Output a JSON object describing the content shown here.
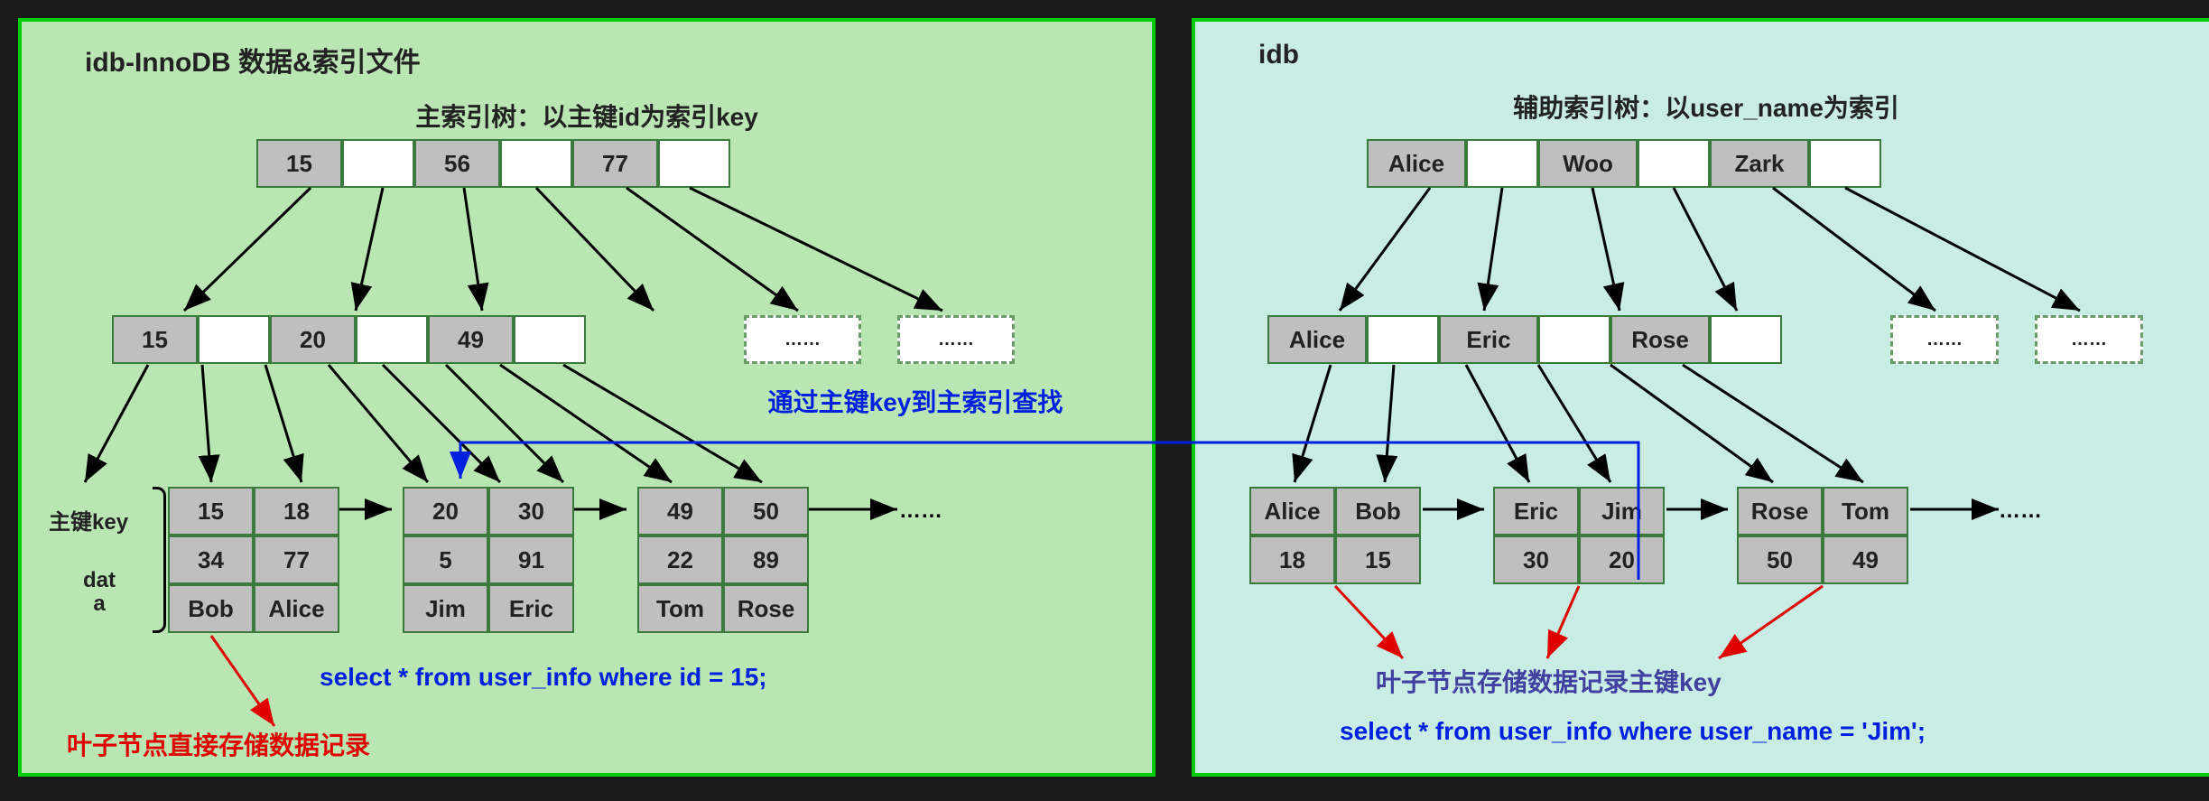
{
  "left_panel": {
    "title": "idb-InnoDB 数据&索引文件",
    "tree_title": "主索引树：以主键id为索引key",
    "root": [
      "15",
      "",
      "56",
      "",
      "77",
      ""
    ],
    "mid": [
      "15",
      "",
      "20",
      "",
      "49",
      ""
    ],
    "dashed_cell": "……",
    "leaf_label_key": "主键key",
    "leaf_label_data1": "dat",
    "leaf_label_data2": "a",
    "leaf1": [
      [
        "15",
        "18"
      ],
      [
        "34",
        "77"
      ],
      [
        "Bob",
        "Alice"
      ]
    ],
    "leaf2": [
      [
        "20",
        "30"
      ],
      [
        "5",
        "91"
      ],
      [
        "Jim",
        "Eric"
      ]
    ],
    "leaf3": [
      [
        "49",
        "50"
      ],
      [
        "22",
        "89"
      ],
      [
        "Tom",
        "Rose"
      ]
    ],
    "leaf_ellipsis": "……",
    "lookup_note": "通过主键key到主索引查找",
    "sql": "select  * from user_info  where id = 15;",
    "leaf_note": "叶子节点直接存储数据记录"
  },
  "right_panel": {
    "title": "idb",
    "tree_title": "辅助索引树：以user_name为索引",
    "root": [
      "Alice",
      "",
      "Woo",
      "",
      "Zark",
      ""
    ],
    "mid": [
      "Alice",
      "",
      "Eric",
      "",
      "Rose",
      ""
    ],
    "dashed_cell": "……",
    "leaf1": [
      [
        "Alice",
        "Bob"
      ],
      [
        "18",
        "15"
      ]
    ],
    "leaf2": [
      [
        "Eric",
        "Jim"
      ],
      [
        "30",
        "20"
      ]
    ],
    "leaf3": [
      [
        "Rose",
        "Tom"
      ],
      [
        "50",
        "49"
      ]
    ],
    "leaf_ellipsis": "……",
    "leaf_note": "叶子节点存储数据记录主键key",
    "sql": "select  * from user_info  where user_name = 'Jim';"
  }
}
